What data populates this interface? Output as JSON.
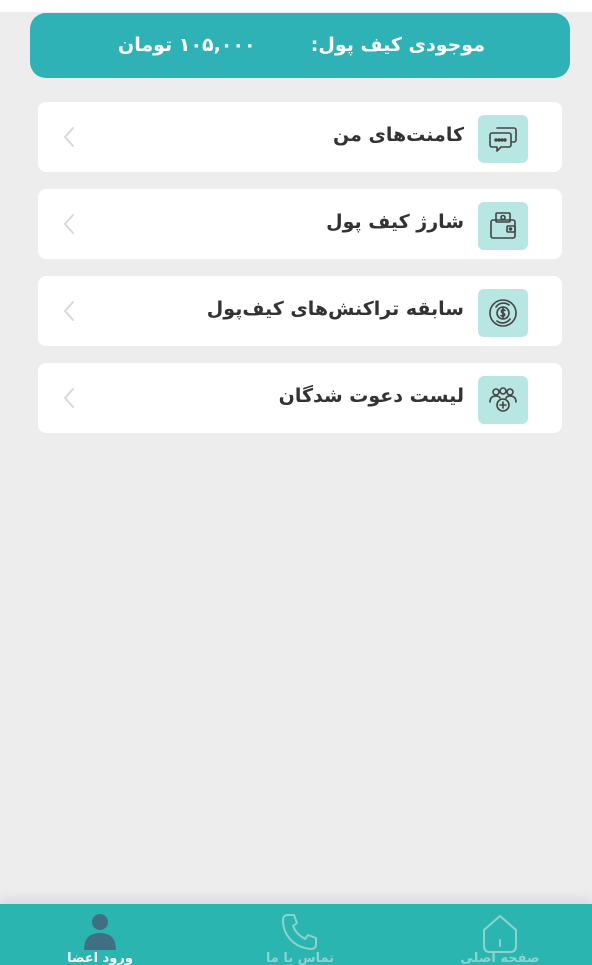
{
  "wallet": {
    "label": "موجودی کیف پول:",
    "balance": "۱۰۵,۰۰۰ تومان"
  },
  "menu": [
    {
      "label": "کامنت‌های من",
      "icon": "comments-icon"
    },
    {
      "label": "شارژ کیف پول",
      "icon": "wallet-icon"
    },
    {
      "label": "سابقه تراکنش‌های کیف‌پول",
      "icon": "transactions-icon"
    },
    {
      "label": "لیست دعوت شدگان",
      "icon": "group-icon"
    }
  ],
  "bottom_nav": {
    "home_label": "صفحه اصلی",
    "contact_label": "تماس با ما",
    "login_label": "ورود اعضا"
  },
  "colors": {
    "accent": "#2fb2b6",
    "nav_bg": "#2ab5b0",
    "icon_bg": "#b8e6e3",
    "page_bg": "#ededed"
  }
}
